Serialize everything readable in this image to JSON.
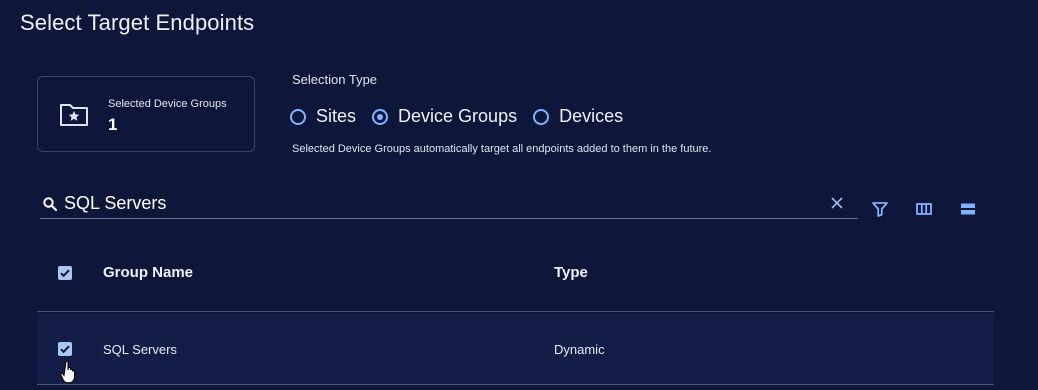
{
  "page": {
    "title": "Select Target Endpoints"
  },
  "summary_card": {
    "icon": "folder-star-icon",
    "label": "Selected Device Groups",
    "count": "1"
  },
  "selection_type": {
    "label": "Selection Type",
    "options": [
      {
        "label": "Sites",
        "selected": false
      },
      {
        "label": "Device Groups",
        "selected": true
      },
      {
        "label": "Devices",
        "selected": false
      }
    ],
    "helper_text": "Selected Device Groups automatically target all endpoints added to them in the future."
  },
  "search": {
    "value": "SQL Servers",
    "icon": "search-icon",
    "clear_icon": "close-icon"
  },
  "toolbar": {
    "icons": [
      "filter-icon",
      "columns-icon",
      "density-icon"
    ]
  },
  "table": {
    "columns": [
      "Group Name",
      "Type"
    ],
    "header_checkbox_checked": true,
    "rows": [
      {
        "checked": true,
        "group_name": "SQL Servers",
        "type": "Dynamic"
      }
    ]
  },
  "colors": {
    "background": "#0e1739",
    "accent": "#7fb2ff",
    "row_background": "#131d47"
  }
}
